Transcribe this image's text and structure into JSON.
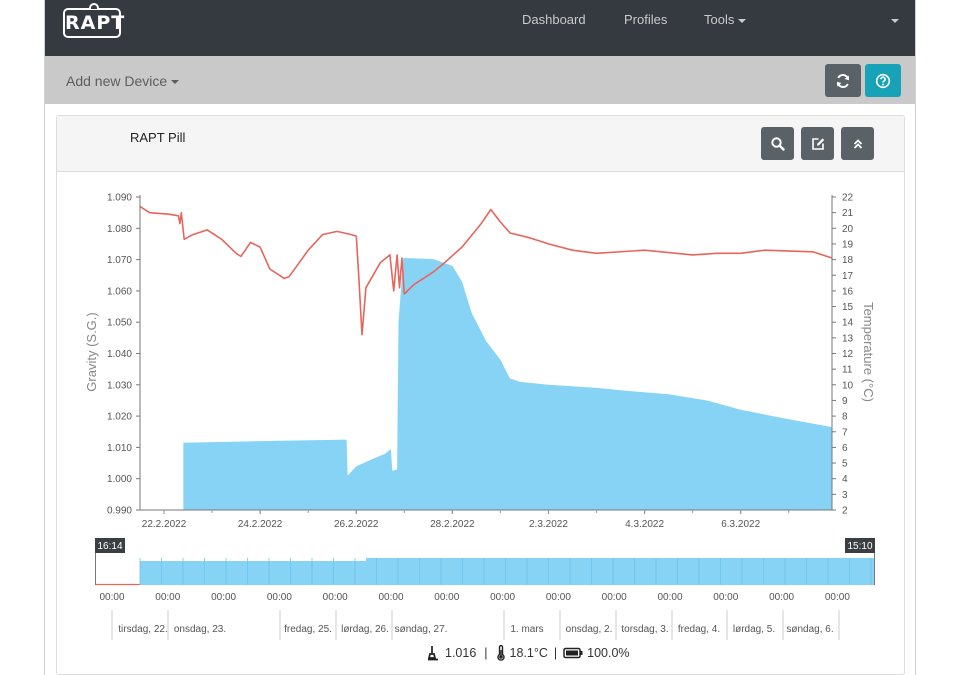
{
  "navbar": {
    "logo_text": "RAPT",
    "links": [
      {
        "label": "Dashboard"
      },
      {
        "label": "Profiles"
      },
      {
        "label": "Tools"
      }
    ]
  },
  "toolbar": {
    "add_device_label": "Add new Device",
    "refresh_icon": "refresh-icon",
    "help_icon": "question-circle-icon",
    "help_color": "#17a2b8"
  },
  "card": {
    "title": "RAPT Pill",
    "buttons": [
      {
        "icon": "search-icon"
      },
      {
        "icon": "edit-icon"
      },
      {
        "icon": "collapse-icon"
      }
    ]
  },
  "navigator": {
    "start_label": "16:14",
    "end_label": "15:10",
    "time_label": "00:00",
    "day_labels": [
      "tirsdag, 22.",
      "onsdag, 23.",
      "fredag, 25.",
      "lørdag, 26.",
      "søndag, 27.",
      "1. mars",
      "onsdag, 2.",
      "torsdag, 3.",
      "fredag, 4.",
      "lørdag, 5.",
      "søndag, 6."
    ]
  },
  "status": {
    "gravity": "1.016",
    "temperature": "18.1°C",
    "battery": "100.0%",
    "separator": "|"
  },
  "chart_data": {
    "type": "area",
    "xlabel": "",
    "ylabel": "Gravity (S.G.)",
    "y2label": "Temperature (°C)",
    "x_ticks": [
      "22.2.2022",
      "24.2.2022",
      "26.2.2022",
      "28.2.2022",
      "2.3.2022",
      "4.3.2022",
      "6.3.2022"
    ],
    "x_range_days": [
      -0.5,
      13.9
    ],
    "ylim": [
      0.99,
      1.09
    ],
    "y_ticks": [
      "0.990",
      "1.000",
      "1.010",
      "1.020",
      "1.030",
      "1.040",
      "1.050",
      "1.060",
      "1.070",
      "1.080",
      "1.090"
    ],
    "y2lim": [
      2,
      22
    ],
    "y2_ticks": [
      "2",
      "3",
      "4",
      "5",
      "6",
      "7",
      "8",
      "9",
      "10",
      "11",
      "12",
      "13",
      "14",
      "15",
      "16",
      "17",
      "18",
      "19",
      "20",
      "21",
      "22"
    ],
    "series": [
      {
        "type": "area",
        "axis": "gravity",
        "color": "#87d3f5",
        "points": [
          [
            0.4,
            1.0115
          ],
          [
            2.0,
            1.012
          ],
          [
            3.8,
            1.0125
          ],
          [
            3.82,
            1.001
          ],
          [
            4.0,
            1.004
          ],
          [
            4.3,
            1.006
          ],
          [
            4.6,
            1.008
          ],
          [
            4.72,
            1.0095
          ],
          [
            4.75,
            1.0025
          ],
          [
            4.85,
            1.003
          ],
          [
            4.88,
            1.05
          ],
          [
            4.98,
            1.0705
          ],
          [
            5.6,
            1.0702
          ],
          [
            6.0,
            1.068
          ],
          [
            6.2,
            1.063
          ],
          [
            6.4,
            1.053
          ],
          [
            6.7,
            1.044
          ],
          [
            7.0,
            1.038
          ],
          [
            7.2,
            1.032
          ],
          [
            7.4,
            1.031
          ],
          [
            8.0,
            1.03
          ],
          [
            9.0,
            1.029
          ],
          [
            9.7,
            1.028
          ],
          [
            10.5,
            1.027
          ],
          [
            11.3,
            1.025
          ],
          [
            12.0,
            1.022
          ],
          [
            13.0,
            1.019
          ],
          [
            13.9,
            1.0165
          ]
        ]
      },
      {
        "type": "line",
        "axis": "temperature",
        "color": "#e8655c",
        "points": [
          [
            -0.5,
            21.4
          ],
          [
            -0.3,
            21.0
          ],
          [
            0.1,
            20.9
          ],
          [
            0.3,
            20.8
          ],
          [
            0.33,
            20.3
          ],
          [
            0.36,
            21.0
          ],
          [
            0.42,
            19.3
          ],
          [
            0.6,
            19.6
          ],
          [
            0.9,
            19.9
          ],
          [
            1.2,
            19.3
          ],
          [
            1.5,
            18.4
          ],
          [
            1.6,
            18.2
          ],
          [
            1.8,
            19.1
          ],
          [
            2.0,
            18.8
          ],
          [
            2.2,
            17.4
          ],
          [
            2.5,
            16.8
          ],
          [
            2.6,
            16.9
          ],
          [
            3.0,
            18.6
          ],
          [
            3.3,
            19.6
          ],
          [
            3.6,
            19.8
          ],
          [
            3.9,
            19.6
          ],
          [
            4.0,
            19.5
          ],
          [
            4.05,
            17.0
          ],
          [
            4.12,
            13.2
          ],
          [
            4.2,
            16.2
          ],
          [
            4.5,
            17.8
          ],
          [
            4.7,
            18.3
          ],
          [
            4.78,
            16.0
          ],
          [
            4.85,
            18.3
          ],
          [
            4.9,
            16.2
          ],
          [
            4.95,
            18.1
          ],
          [
            5.0,
            15.8
          ],
          [
            5.2,
            16.4
          ],
          [
            5.6,
            17.2
          ],
          [
            5.8,
            17.7
          ],
          [
            6.2,
            18.8
          ],
          [
            6.6,
            20.3
          ],
          [
            6.8,
            21.2
          ],
          [
            7.0,
            20.4
          ],
          [
            7.2,
            19.7
          ],
          [
            7.6,
            19.4
          ],
          [
            8.0,
            19.0
          ],
          [
            8.5,
            18.6
          ],
          [
            9.0,
            18.4
          ],
          [
            10.0,
            18.6
          ],
          [
            11.0,
            18.3
          ],
          [
            11.5,
            18.4
          ],
          [
            12.0,
            18.4
          ],
          [
            12.5,
            18.6
          ],
          [
            13.5,
            18.5
          ],
          [
            13.9,
            18.1
          ]
        ]
      }
    ]
  }
}
